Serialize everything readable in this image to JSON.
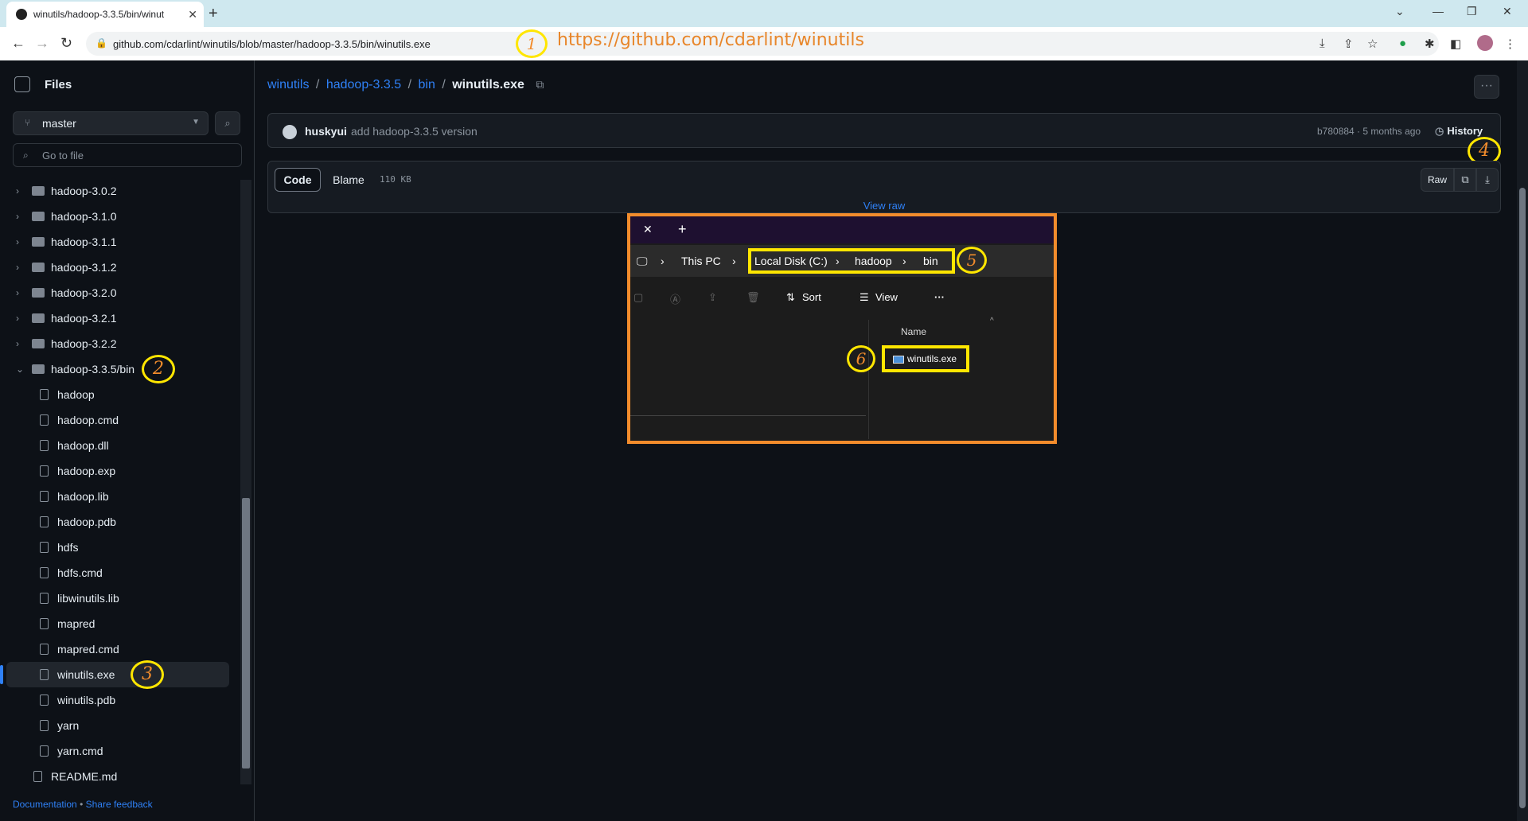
{
  "browser": {
    "tab_title": "winutils/hadoop-3.3.5/bin/winut",
    "url": "github.com/cdarlint/winutils/blob/master/hadoop-3.3.5/bin/winutils.exe"
  },
  "annotations": {
    "url_text": "https://github.com/cdarlint/winutils",
    "n1": "1",
    "n2": "2",
    "n3": "3",
    "n4": "4",
    "n5": "5",
    "n6": "6"
  },
  "sidebar": {
    "title": "Files",
    "branch": "master",
    "goto_placeholder": "Go to file",
    "folders": [
      {
        "label": "hadoop-3.0.2"
      },
      {
        "label": "hadoop-3.1.0"
      },
      {
        "label": "hadoop-3.1.1"
      },
      {
        "label": "hadoop-3.1.2"
      },
      {
        "label": "hadoop-3.2.0"
      },
      {
        "label": "hadoop-3.2.1"
      },
      {
        "label": "hadoop-3.2.2"
      },
      {
        "label": "hadoop-3.3.5/bin"
      }
    ],
    "files": [
      {
        "label": "hadoop"
      },
      {
        "label": "hadoop.cmd"
      },
      {
        "label": "hadoop.dll"
      },
      {
        "label": "hadoop.exp"
      },
      {
        "label": "hadoop.lib"
      },
      {
        "label": "hadoop.pdb"
      },
      {
        "label": "hdfs"
      },
      {
        "label": "hdfs.cmd"
      },
      {
        "label": "libwinutils.lib"
      },
      {
        "label": "mapred"
      },
      {
        "label": "mapred.cmd"
      },
      {
        "label": "winutils.exe"
      },
      {
        "label": "winutils.pdb"
      },
      {
        "label": "yarn"
      },
      {
        "label": "yarn.cmd"
      }
    ],
    "readme": "README.md",
    "footer_docs": "Documentation",
    "footer_sep": "•",
    "footer_feedback": "Share feedback"
  },
  "breadcrumb": {
    "repo": "winutils",
    "folder": "hadoop-3.3.5",
    "sub": "bin",
    "file": "winutils.exe",
    "sep": "/"
  },
  "commit": {
    "user": "huskyui",
    "message": "add hadoop-3.3.5 version",
    "meta": "b780884 · 5 months ago",
    "history_label": "History"
  },
  "file_view": {
    "code_label": "Code",
    "blame_label": "Blame",
    "size": "110 KB",
    "raw_label": "Raw",
    "view_raw": "View raw"
  },
  "explorer": {
    "path": [
      "This PC",
      "Local Disk (C:)",
      "hadoop",
      "bin"
    ],
    "sort_label": "Sort",
    "view_label": "View",
    "more": "···",
    "column_name": "Name",
    "file": "winutils.exe"
  },
  "colors": {
    "accent_link": "#2f81f7",
    "annotation_orange": "#f28c2c",
    "annotation_yellow": "#ffe600"
  }
}
